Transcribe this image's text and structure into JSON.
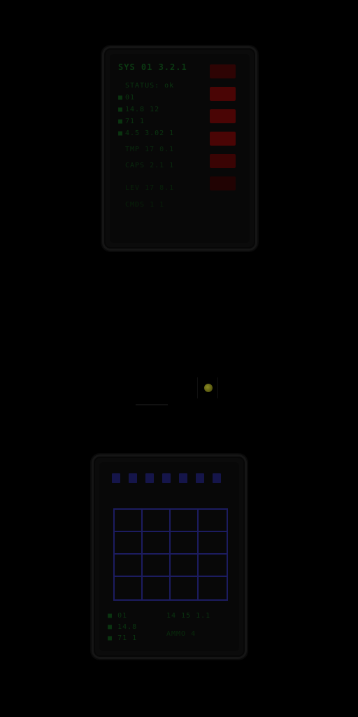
{
  "colors": {
    "background": "#000000",
    "terminal_text": "#0a3510",
    "status_led": "#4a0505",
    "grid_line": "#1c1c60",
    "beacon": "#8a8a22"
  },
  "top_panel": {
    "title": "SYS 01 3.2.1",
    "lines": [
      {
        "bullet": "",
        "text": "STATUS: ok"
      },
      {
        "bullet": "■",
        "text": "01"
      },
      {
        "bullet": "■",
        "text": "14.8 12"
      },
      {
        "bullet": "■",
        "text": "71 1"
      },
      {
        "bullet": "■",
        "text": "4.5 3.02 1"
      },
      {
        "bullet": "",
        "text": "TMP 17 0.1"
      },
      {
        "bullet": "",
        "text": "CAPS 2.1 1"
      },
      {
        "bullet": "",
        "text": "LEV 17 8.1"
      },
      {
        "bullet": "",
        "text": "CMDS 1 1"
      }
    ],
    "leds": [
      {
        "state": "dim"
      },
      {
        "state": "on"
      },
      {
        "state": "on"
      },
      {
        "state": "on"
      },
      {
        "state": "on"
      },
      {
        "state": "dim"
      }
    ]
  },
  "beacon": {
    "icon": "beacon-light-icon"
  },
  "bottom_panel": {
    "tabs_count": 7,
    "grid": {
      "rows": 4,
      "cols": 4
    },
    "stats_left": [
      {
        "bullet": "■",
        "text": "01"
      },
      {
        "bullet": "■",
        "text": "14.8"
      },
      {
        "bullet": "■",
        "text": "71 1"
      }
    ],
    "stats_right": [
      {
        "text": "14 15 1.1"
      },
      {
        "text": "AMMO 4"
      }
    ]
  }
}
